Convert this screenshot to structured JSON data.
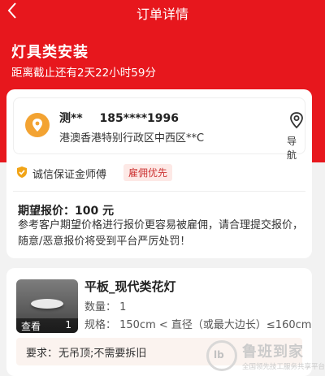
{
  "header": {
    "title": "订单详情"
  },
  "order": {
    "service_title": "灯具类安装",
    "deadline": "距离截止还有2天22小时59分"
  },
  "customer": {
    "name": "测**",
    "phone": "185****1996",
    "address": "港澳香港特别行政区中西区**C",
    "nav_label": "导航"
  },
  "guarantee": {
    "text": "诚信保证金师傅",
    "badge": "雇佣优先"
  },
  "price": {
    "label": "期望报价：",
    "value": "100 元",
    "note": "参考客户期望价格进行报价更容易被雇佣，请合理提交报价，随意/恶意报价将受到平台严厉处罚！"
  },
  "item": {
    "view_label": "查看",
    "view_count": "1",
    "name": "平板_现代类花灯",
    "qty": "数量： 1",
    "spec": "规格： 150cm < 直径（或最大边长）≤160cm"
  },
  "requirement": {
    "label": "要求：",
    "value": "无吊顶;不需要拆旧"
  },
  "watermark": {
    "title": "鲁班到家",
    "subtitle": "全国领先技工服务共享平台",
    "logo_text": "lb"
  },
  "colors": {
    "brand": "#e7171d",
    "pin": "#f3a332",
    "badge_text": "#c33333"
  }
}
